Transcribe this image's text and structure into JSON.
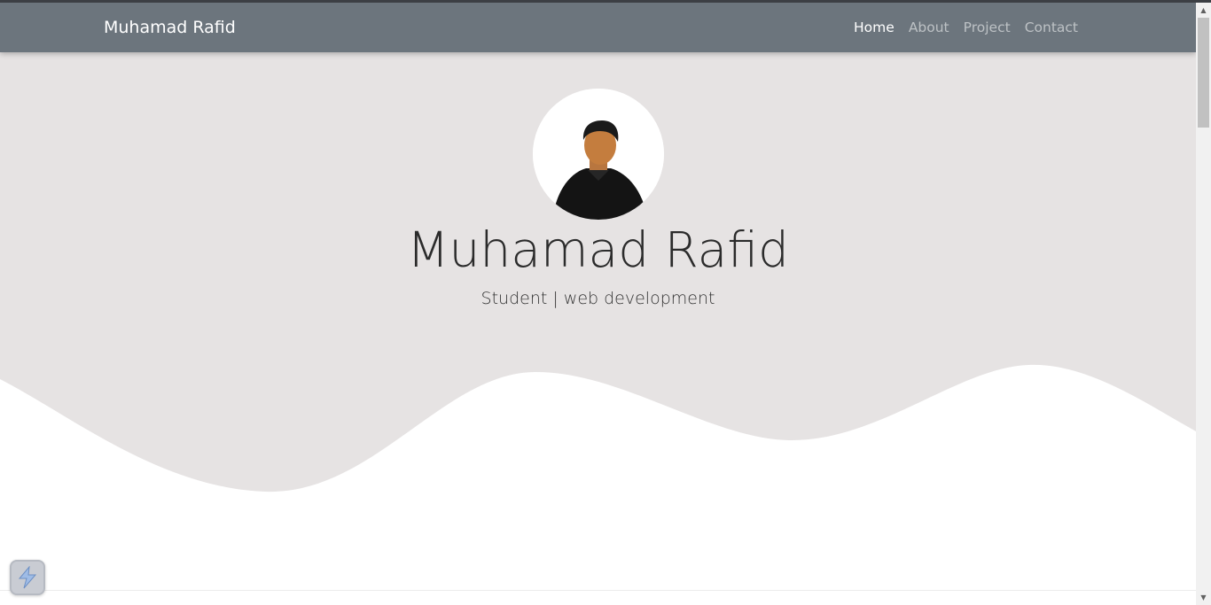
{
  "navbar": {
    "brand": "Muhamad Rafid",
    "links": [
      {
        "label": "Home",
        "active": true
      },
      {
        "label": "About",
        "active": false
      },
      {
        "label": "Project",
        "active": false
      },
      {
        "label": "Contact",
        "active": false
      }
    ]
  },
  "hero": {
    "name": "Muhamad Rafid",
    "tagline": "Student | web development",
    "background_color": "#e6e3e3",
    "wave_color": "#ffffff"
  },
  "colors": {
    "navbar": "#6c757d",
    "text_dark": "#2b2b2b"
  },
  "icons": {
    "widget": "lightning-bolt-icon",
    "scroll_up": "triangle-up-icon",
    "scroll_down": "triangle-down-icon"
  }
}
